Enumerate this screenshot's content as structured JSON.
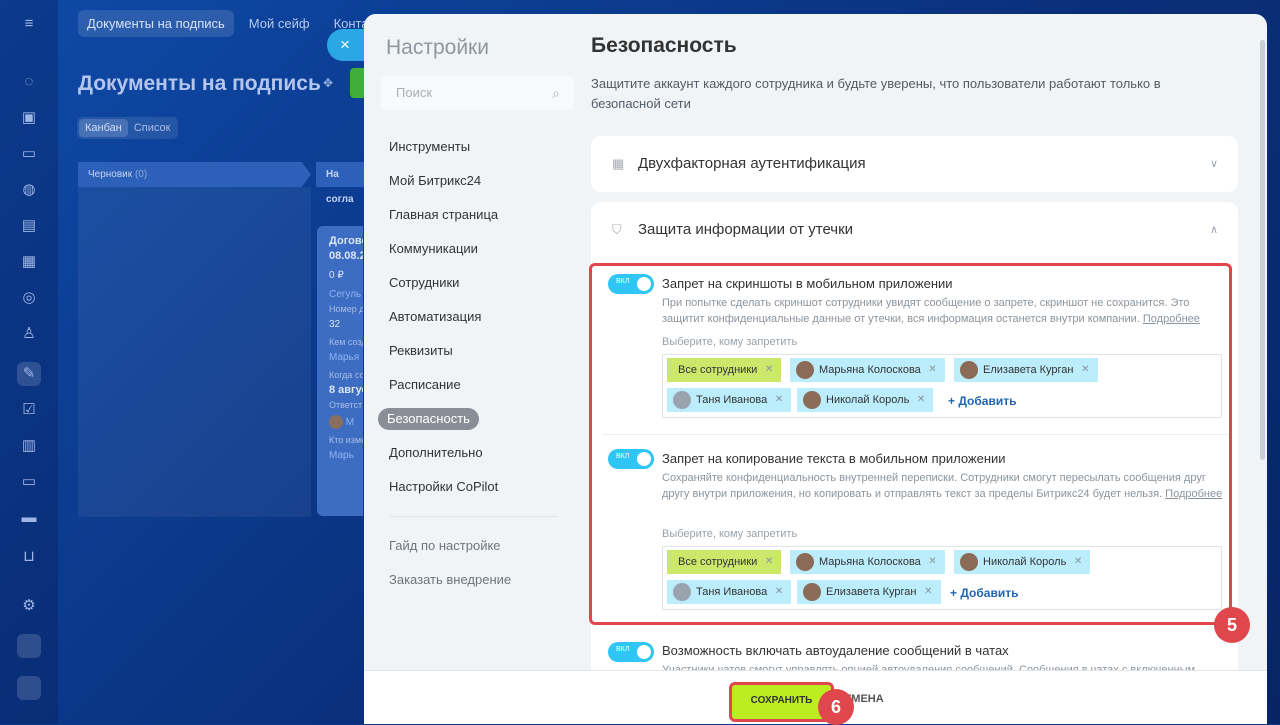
{
  "background": {
    "tabs": [
      "Документы на подпись",
      "Мой сейф",
      "Конта"
    ],
    "page_title": "Документы на подпись",
    "views": [
      "Канбан",
      "Список"
    ],
    "columns": [
      {
        "label": "Черновик",
        "count": "(0)"
      },
      {
        "label": "На согла"
      }
    ],
    "card": {
      "title": "Догово",
      "date": "08.08.2",
      "amount": "0 ₽",
      "company": "Сегуль",
      "number_label": "Номер д",
      "number": "32",
      "created_label": "Кем созд",
      "created_by": "Марья",
      "when_label": "Когда со",
      "when": "8 август",
      "resp_label": "Ответст",
      "resp": "М",
      "who_label": "Кто изме",
      "who": "Марь"
    }
  },
  "close_icon": "×",
  "settings": {
    "title": "Настройки",
    "search_placeholder": "Поиск",
    "nav": [
      "Инструменты",
      "Мой Битрикс24",
      "Главная страница",
      "Коммуникации",
      "Сотрудники",
      "Автоматизация",
      "Реквизиты",
      "Расписание",
      "Безопасность",
      "Дополнительно",
      "Настройки CoPilot"
    ],
    "nav_selected": "Безопасность",
    "nav_bottom": [
      "Гайд по настройке",
      "Заказать внедрение"
    ]
  },
  "main": {
    "title": "Безопасность",
    "description": "Защитите аккаунт каждого сотрудника и будьте уверены, что пользователи работают только в безопасной сети",
    "sections": [
      {
        "title": "Двухфакторная аутентификация",
        "expanded": false
      },
      {
        "title": "Защита информации от утечки",
        "expanded": true
      }
    ],
    "toggle_label": "ВКЛ",
    "items": [
      {
        "title": "Запрет на скриншоты в мобильном приложении",
        "desc": "При попытке сделать скриншот сотрудники увидят сообщение о запрете, скриншот не сохранится. Это защитит конфиденциальные данные от утечки, вся информация останется внутри компании.",
        "more": "Подробнее",
        "choose": "Выберите, кому запретить",
        "chips_row1": [
          "Все сотрудники",
          "Марьяна Колоскова",
          "Елизавета Курган"
        ],
        "chips_row2": [
          "Таня Иванова",
          "Николай Король"
        ],
        "add": "+ Добавить"
      },
      {
        "title": "Запрет на копирование текста в мобильном приложении",
        "desc": "Сохраняйте конфиденциальность внутренней переписки. Сотрудники смогут пересылать сообщения друг другу внутри приложения, но копировать и отправлять текст за пределы Битрикс24 будет нельзя.",
        "more": "Подробнее",
        "choose": "Выберите, кому запретить",
        "chips_row1": [
          "Все сотрудники",
          "Марьяна Колоскова",
          "Николай Король"
        ],
        "chips_row2": [
          "Таня Иванова",
          "Елизавета Курган"
        ],
        "add": "+ Добавить"
      },
      {
        "title": "Возможность включать автоудаление сообщений в чатах",
        "desc": "Участники чатов смогут управлять опцией автоудаления сообщений. Сообщения в чатах с включенным"
      }
    ]
  },
  "footer": {
    "save": "СОХРАНИТЬ",
    "cancel": "ОТМЕНА"
  },
  "badges": {
    "five": "5",
    "six": "6"
  },
  "colors": {
    "accent": "#2fc6f6",
    "save": "#bbed21",
    "highlight": "#e0474c",
    "chip": "#bcedfc",
    "chip_all": "#cbe86a"
  }
}
